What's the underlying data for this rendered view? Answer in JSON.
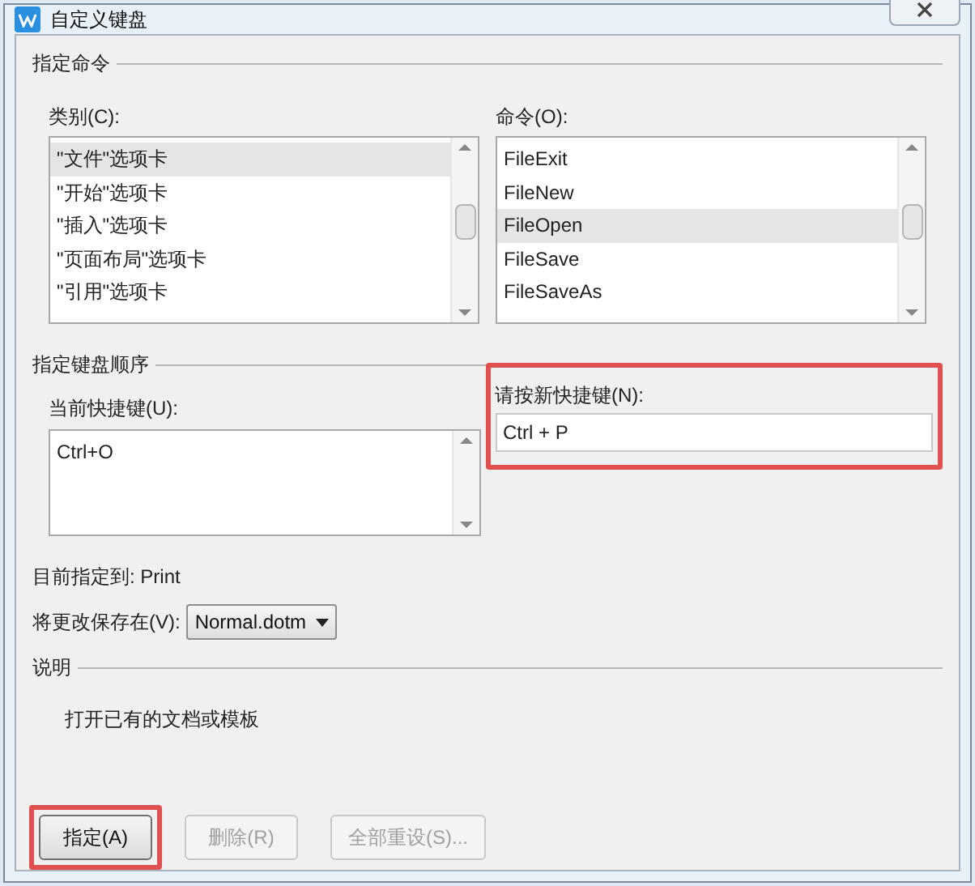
{
  "window": {
    "title": "自定义键盘"
  },
  "command_section": {
    "title": "指定命令",
    "category": {
      "label": "类别(C):",
      "items": [
        {
          "label": "\"文件\"选项卡",
          "selected": true
        },
        {
          "label": "\"开始\"选项卡",
          "selected": false
        },
        {
          "label": "\"插入\"选项卡",
          "selected": false
        },
        {
          "label": "\"页面布局\"选项卡",
          "selected": false
        },
        {
          "label": "\"引用\"选项卡",
          "selected": false
        }
      ]
    },
    "command": {
      "label": "命令(O):",
      "items": [
        {
          "label": "FileExit",
          "selected": false
        },
        {
          "label": "FileNew",
          "selected": false
        },
        {
          "label": "FileOpen",
          "selected": true
        },
        {
          "label": "FileSave",
          "selected": false
        },
        {
          "label": "FileSaveAs",
          "selected": false
        }
      ]
    }
  },
  "keyboard_section": {
    "title": "指定键盘顺序",
    "current": {
      "label": "当前快捷键(U):",
      "keys": [
        "Ctrl+O"
      ]
    },
    "new_shortcut": {
      "label": "请按新快捷键(N):",
      "value": "Ctrl + P",
      "highlighted": true
    }
  },
  "assigned_to": "目前指定到: Print",
  "save_in": {
    "label": "将更改保存在(V):",
    "value": "Normal.dotm"
  },
  "description": {
    "title": "说明",
    "text": "打开已有的文档或模板"
  },
  "buttons": [
    {
      "label": "指定(A)",
      "disabled": false,
      "highlighted": true
    },
    {
      "label": "删除(R)",
      "disabled": true,
      "highlighted": false
    },
    {
      "label": "全部重设(S)...",
      "disabled": true,
      "highlighted": false
    }
  ]
}
